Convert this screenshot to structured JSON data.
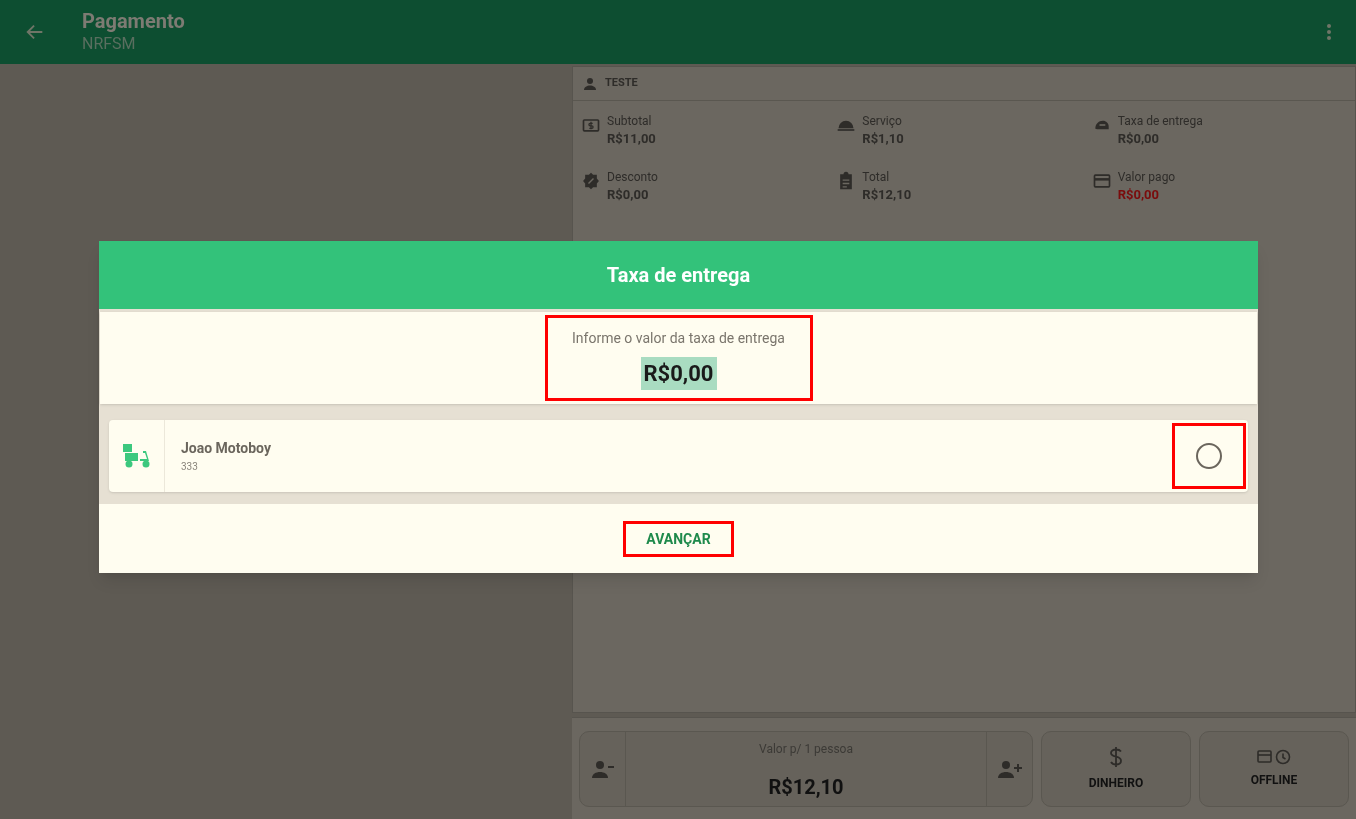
{
  "header": {
    "title": "Pagamento",
    "subtitle": "NRFSM"
  },
  "customer": {
    "name": "TESTE"
  },
  "summary": [
    {
      "kind": "cash",
      "label": "Subtotal",
      "value": "R$11,00",
      "alert": false
    },
    {
      "kind": "service",
      "label": "Serviço",
      "value": "R$1,10",
      "alert": false
    },
    {
      "kind": "delivery",
      "label": "Taxa de entrega",
      "value": "R$0,00",
      "alert": false
    },
    {
      "kind": "discount",
      "label": "Desconto",
      "value": "R$0,00",
      "alert": false
    },
    {
      "kind": "total",
      "label": "Total",
      "value": "R$12,10",
      "alert": false
    },
    {
      "kind": "card",
      "label": "Valor pago",
      "value": "R$0,00",
      "alert": true
    }
  ],
  "bottom_bar": {
    "per_person_label": "Valor p/ 1 pessoa",
    "per_person_value": "R$12,10",
    "buttons": [
      {
        "kind": "cash",
        "label": "DINHEIRO"
      },
      {
        "kind": "offline",
        "label": "OFFLINE"
      }
    ]
  },
  "dialog": {
    "title": "Taxa de entrega",
    "field_label": "Informe o valor da taxa de entrega",
    "field_value": "R$0,00",
    "couriers": [
      {
        "name": "Joao Motoboy",
        "code": "333",
        "selected": false
      }
    ],
    "action": "AVANÇAR"
  }
}
